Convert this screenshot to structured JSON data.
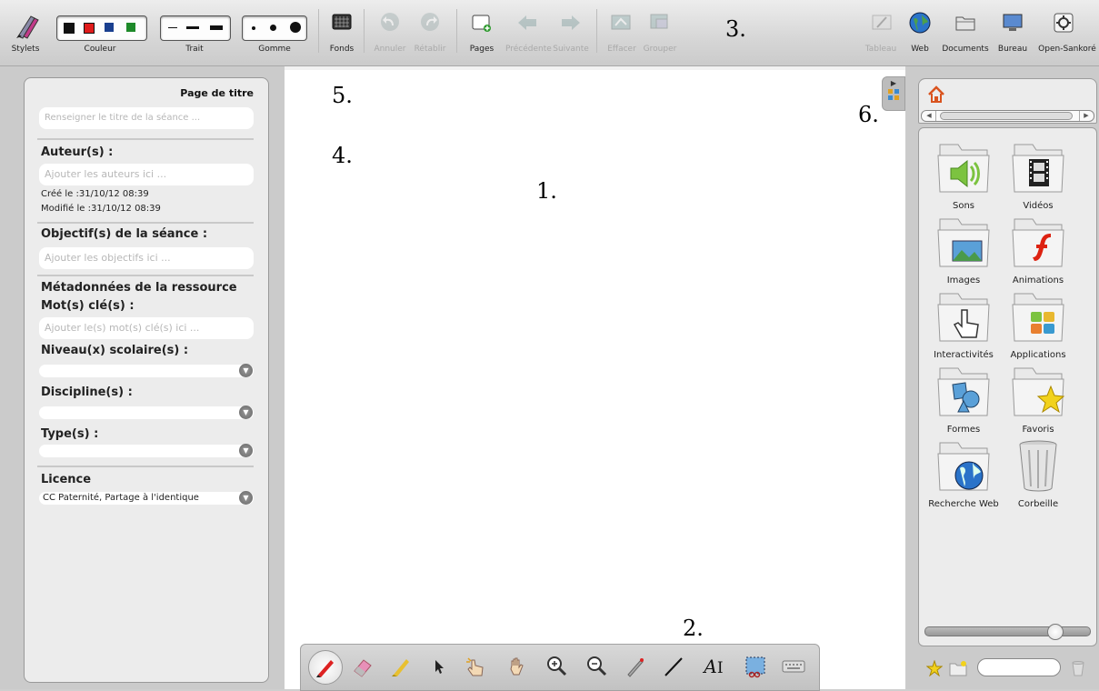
{
  "toolbar": {
    "stylets": "Stylets",
    "couleur": "Couleur",
    "trait": "Trait",
    "gomme": "Gomme",
    "fonds": "Fonds",
    "annuler": "Annuler",
    "retablir": "Rétablir",
    "pages": "Pages",
    "precedente": "Précédente",
    "suivante": "Suivante",
    "effacer": "Effacer",
    "grouper": "Grouper",
    "tableau": "Tableau",
    "web": "Web",
    "documents": "Documents",
    "bureau": "Bureau",
    "open_sankore": "Open-Sankoré",
    "colors": [
      "#111111",
      "#e01b1b",
      "#1a3f8f",
      "#1e8a2a"
    ]
  },
  "annotations": {
    "n1": "1.",
    "n2": "2.",
    "n3": "3.",
    "n4": "4.",
    "n5": "5.",
    "n6": "6."
  },
  "left_panel": {
    "title": "Page de titre",
    "title_placeholder": "Renseigner le titre de la séance ...",
    "authors_heading": "Auteur(s) :",
    "authors_placeholder": "Ajouter les auteurs ici ...",
    "created": "Créé le :31/10/12 08:39",
    "modified": "Modifié le :31/10/12 08:39",
    "objectives_heading": "Objectif(s) de la séance :",
    "objectives_placeholder": "Ajouter les objectifs ici ...",
    "metadata_heading": "Métadonnées de la ressource",
    "keywords_heading": "Mot(s) clé(s) :",
    "keywords_placeholder": "Ajouter le(s) mot(s) clé(s) ici ...",
    "level_heading": "Niveau(x) scolaire(s) :",
    "level_value": "",
    "discipline_heading": "Discipline(s) :",
    "discipline_value": "",
    "type_heading": "Type(s) :",
    "type_value": "",
    "licence_heading": "Licence",
    "licence_value": "CC Paternité, Partage à l'identique"
  },
  "library": {
    "folders": [
      {
        "label": "Sons",
        "icon": "speaker-icon"
      },
      {
        "label": "Vidéos",
        "icon": "film-icon"
      },
      {
        "label": "Images",
        "icon": "picture-icon"
      },
      {
        "label": "Animations",
        "icon": "flash-icon"
      },
      {
        "label": "Interactivités",
        "icon": "hand-pointer-icon"
      },
      {
        "label": "Applications",
        "icon": "apps-icon"
      },
      {
        "label": "Formes",
        "icon": "shapes-icon"
      },
      {
        "label": "Favoris",
        "icon": "star-icon"
      },
      {
        "label": "Recherche Web",
        "icon": "globe-icon"
      },
      {
        "label": "Corbeille",
        "icon": "trash-icon"
      }
    ],
    "zoom_level": 0.82,
    "search_value": ""
  }
}
